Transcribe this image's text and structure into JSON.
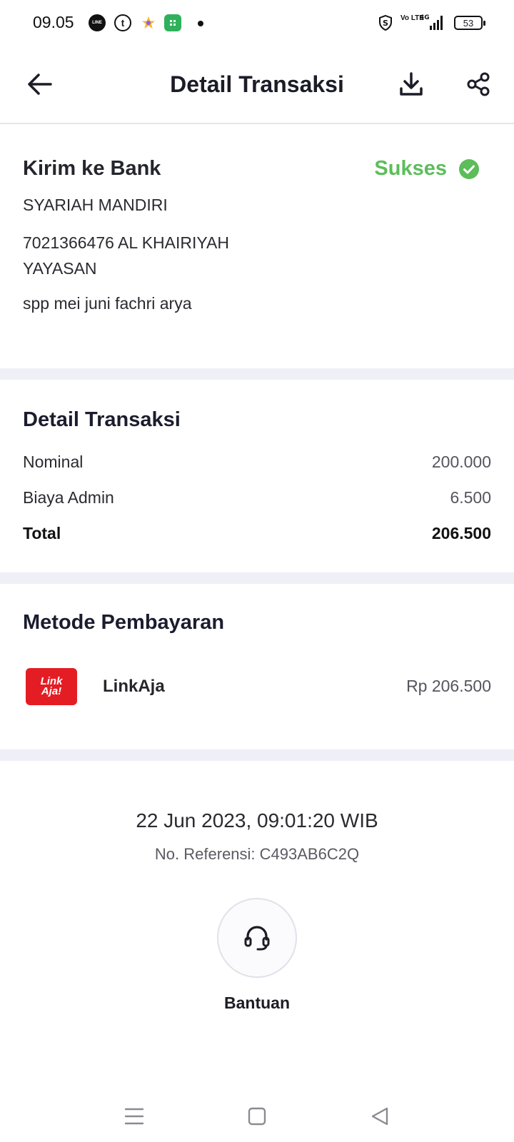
{
  "status_bar": {
    "time": "09.05",
    "battery": "53",
    "network": "4G",
    "volte": "Vo LTE"
  },
  "header": {
    "title": "Detail Transaksi",
    "icons": [
      "back-arrow-icon",
      "download-icon",
      "share-icon"
    ]
  },
  "recipient": {
    "title": "Kirim ke Bank",
    "status": "Sukses",
    "status_color": "#5cbd5a",
    "bank": "SYARIAH MANDIRI",
    "account": "7021366476 AL KHAIRIYAH YAYASAN",
    "note": "spp mei juni fachri arya"
  },
  "details": {
    "title": "Detail Transaksi",
    "rows": [
      {
        "label": "Nominal",
        "value": "200.000"
      },
      {
        "label": "Biaya Admin",
        "value": "6.500"
      },
      {
        "label": "Total",
        "value": "206.500"
      }
    ]
  },
  "payment": {
    "title": "Metode Pembayaran",
    "logo_line1": "Link",
    "logo_line2": "Aja!",
    "method": "LinkAja",
    "amount": "Rp 206.500",
    "brand_color": "#e41d24"
  },
  "footer": {
    "datetime": "22 Jun 2023, 09:01:20 WIB",
    "reference": "No. Referensi: C493AB6C2Q",
    "help_label": "Bantuan"
  }
}
